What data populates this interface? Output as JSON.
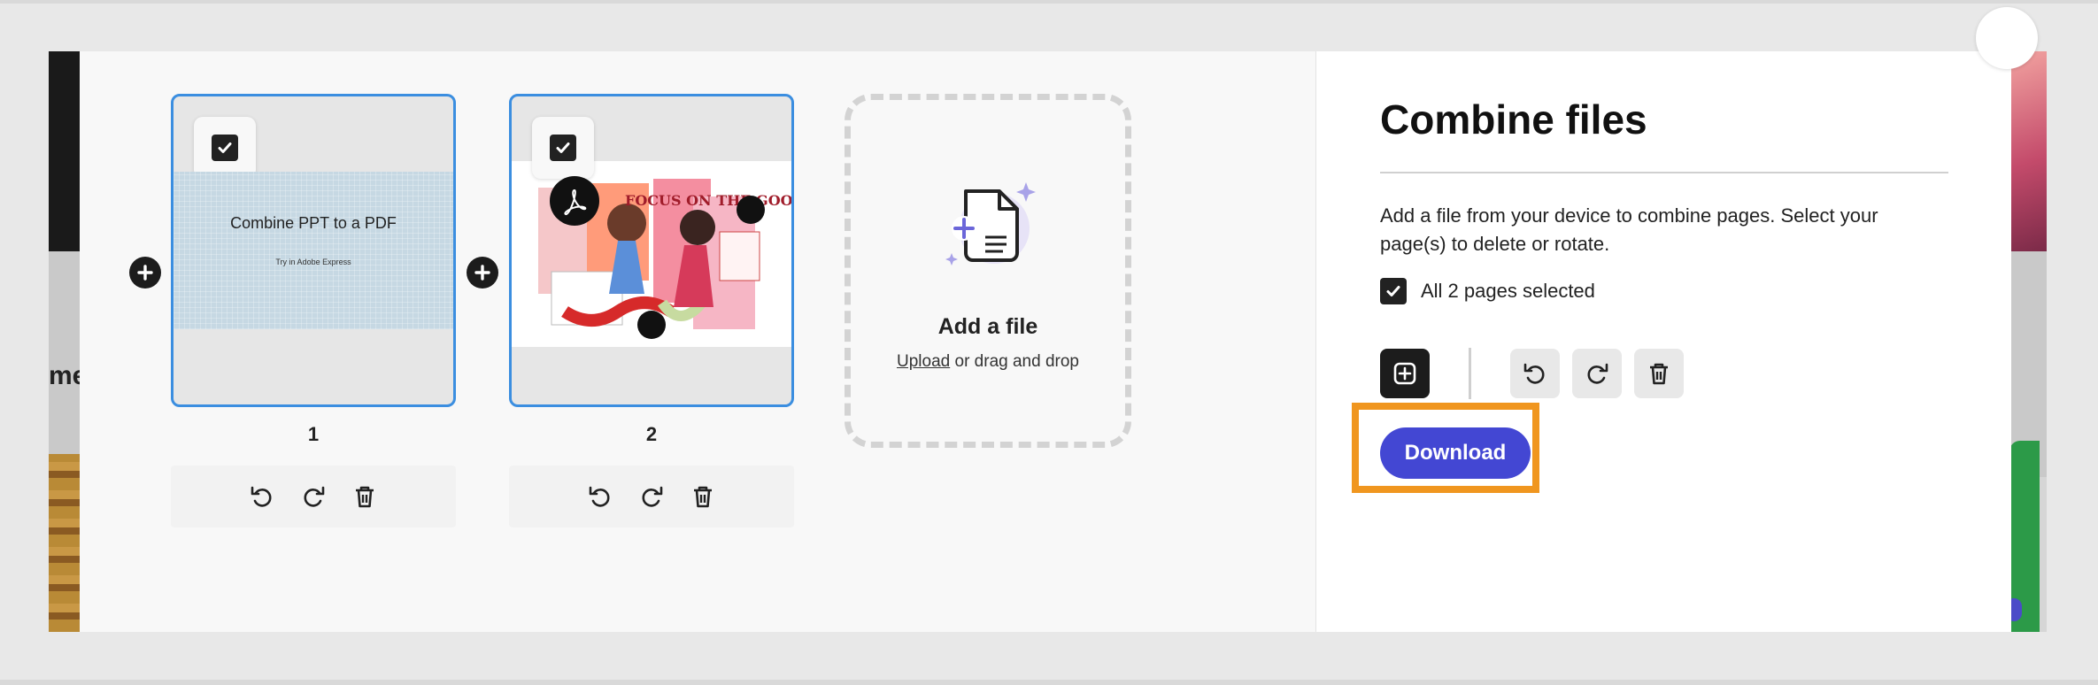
{
  "background_page": {
    "partial_text": "me"
  },
  "pages": [
    {
      "number": "1",
      "selected": true,
      "thumbnail": {
        "title": "Combine PPT to a PDF",
        "subtitle": "Try in Adobe Express"
      }
    },
    {
      "number": "2",
      "selected": true,
      "thumbnail": {
        "headline": "FOCUS ON THE GOOD"
      }
    }
  ],
  "add_file": {
    "title": "Add a file",
    "upload_link": "Upload",
    "upload_rest": " or drag and drop"
  },
  "panel": {
    "title": "Combine files",
    "description": "Add a file from your device to combine pages. Select your page(s) to delete or rotate.",
    "select_all_label": "All 2 pages selected",
    "download_label": "Download"
  },
  "colors": {
    "accent": "#4347d3",
    "selection_border": "#3b8ee0",
    "highlight": "#f0961f"
  },
  "icons": [
    "checkbox-icon",
    "plus-circle-icon",
    "rotate-left-icon",
    "rotate-right-icon",
    "trash-icon",
    "add-file-icon",
    "acrobat-icon"
  ]
}
